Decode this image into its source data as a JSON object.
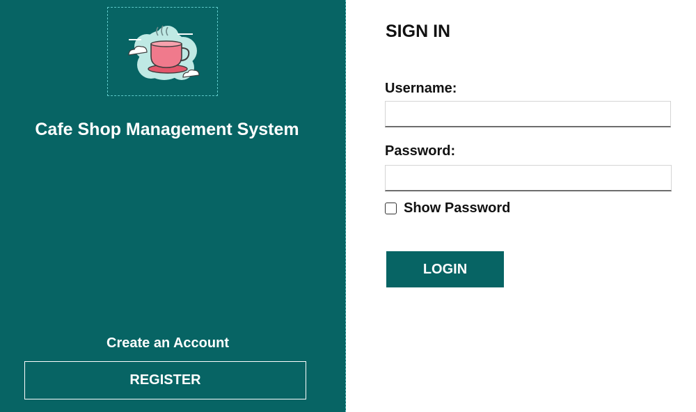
{
  "app": {
    "title": "Cafe Shop Management System",
    "logo_icon": "coffee-cup-icon"
  },
  "left_panel": {
    "create_account_label": "Create an Account",
    "register_label": "REGISTER"
  },
  "signin": {
    "heading": "SIGN IN",
    "username_label": "Username:",
    "username_value": "",
    "password_label": "Password:",
    "password_value": "",
    "show_password_label": "Show Password",
    "show_password_checked": false,
    "login_label": "LOGIN"
  },
  "colors": {
    "primary": "#076464",
    "logo_cloud": "#bfe9e4",
    "cup": "#f07a8c",
    "background": "#ffffff"
  }
}
